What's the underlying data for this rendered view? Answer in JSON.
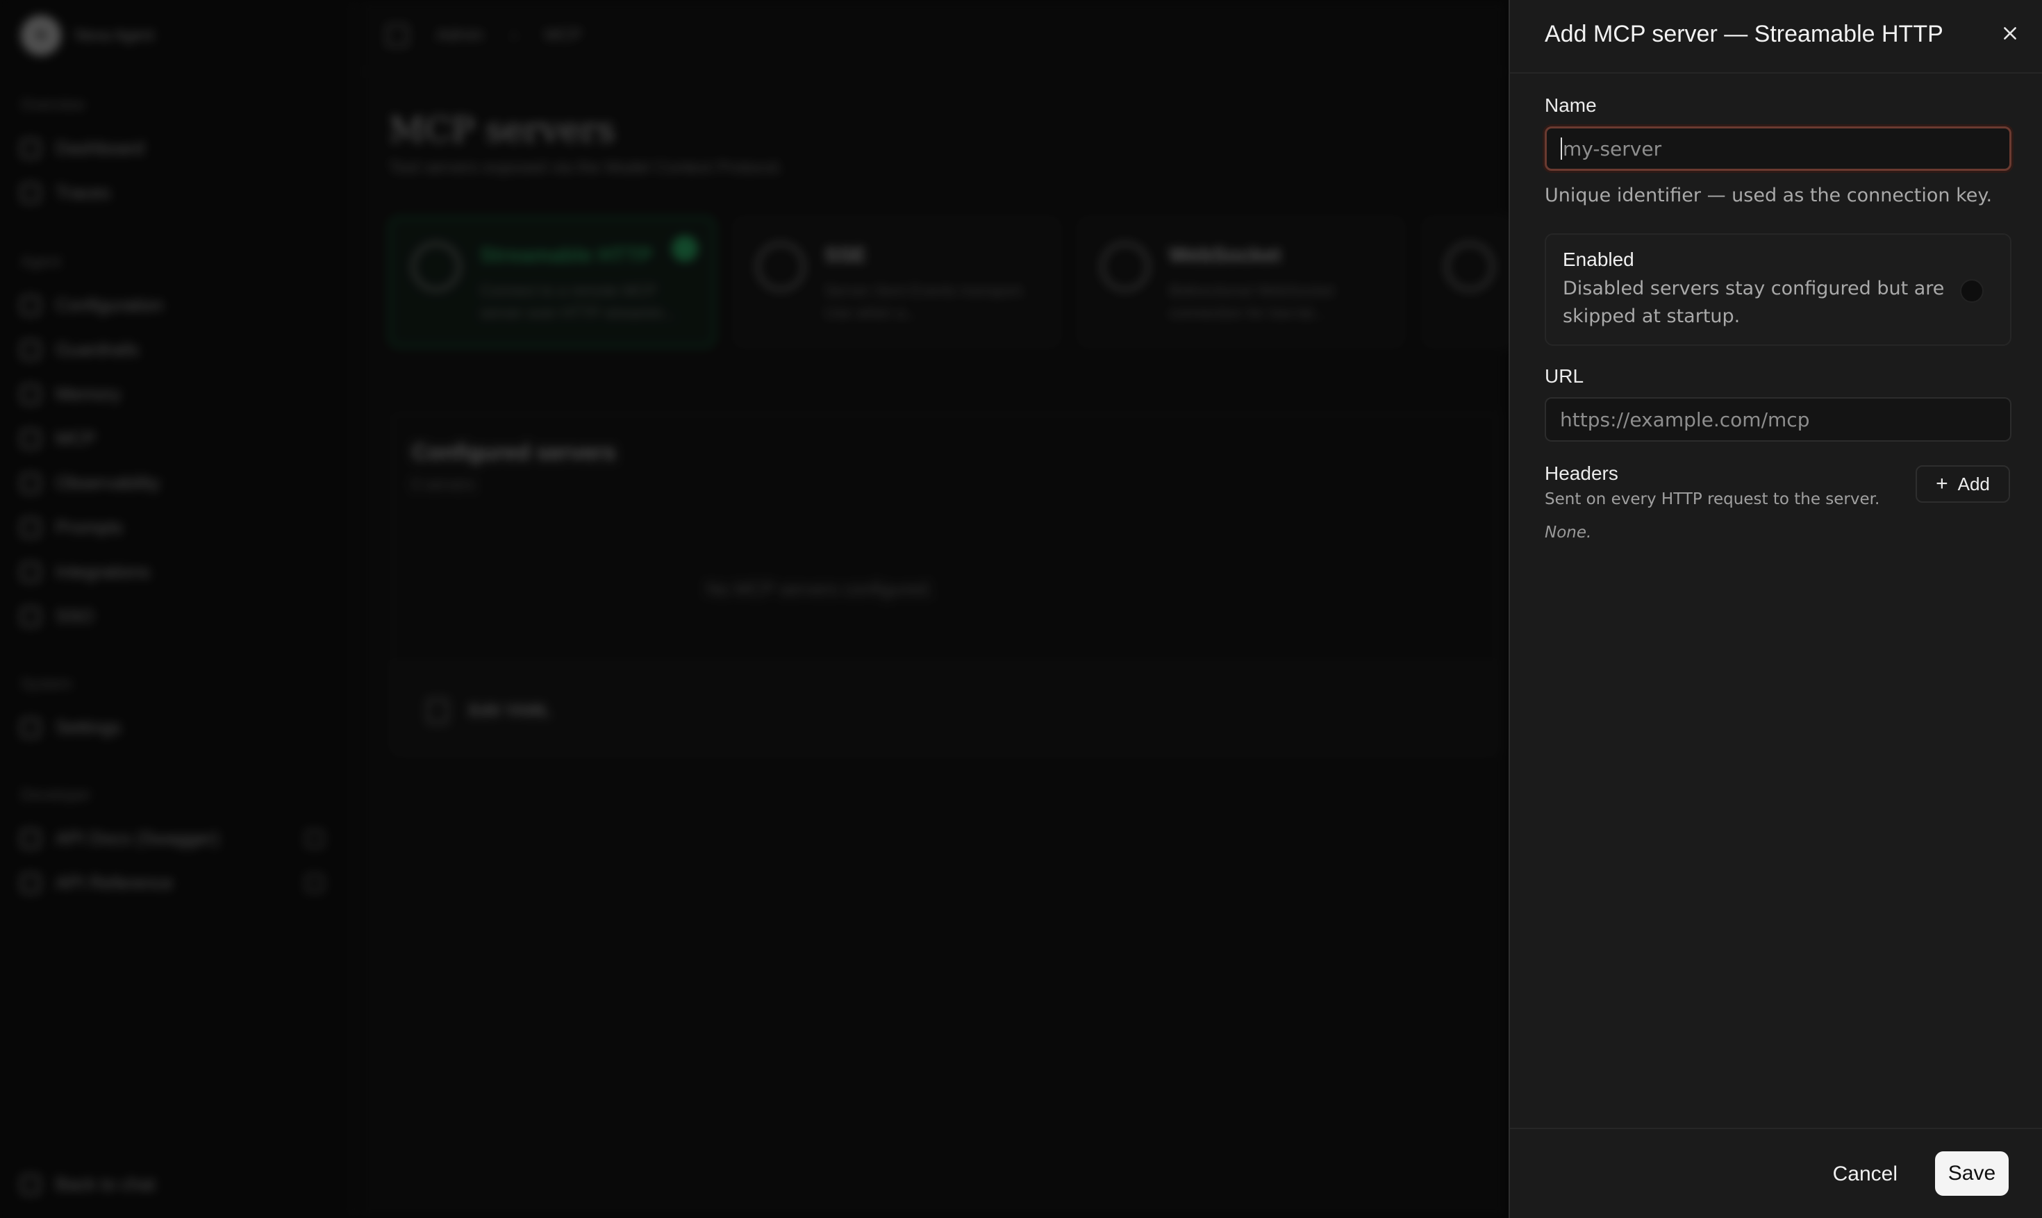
{
  "app": {
    "name": "Nexa Agent",
    "logo_text": "N"
  },
  "sidebar": {
    "sections": [
      {
        "title": "Overview",
        "items": [
          {
            "label": "Dashboard"
          },
          {
            "label": "Traces"
          }
        ]
      },
      {
        "title": "Agent",
        "items": [
          {
            "label": "Configuration"
          },
          {
            "label": "Guardrails"
          },
          {
            "label": "Memory"
          },
          {
            "label": "MCP"
          },
          {
            "label": "Observability"
          },
          {
            "label": "Prompts"
          },
          {
            "label": "Integrations"
          },
          {
            "label": "SSO"
          }
        ]
      },
      {
        "title": "System",
        "items": [
          {
            "label": "Settings"
          }
        ]
      },
      {
        "title": "Developer",
        "items": [
          {
            "label": "API Docs (Swagger)"
          },
          {
            "label": "API Reference"
          }
        ]
      }
    ],
    "back": "Back to chat"
  },
  "breadcrumb": {
    "parent": "Admin",
    "sep": "›",
    "current": "MCP"
  },
  "page": {
    "title": "MCP servers",
    "subtitle": "Tool servers exposed via the Model Context Protocol."
  },
  "transports": [
    {
      "title": "Streamable HTTP",
      "desc": "Connect to a remote MCP server over HTTP streamin...",
      "active": true
    },
    {
      "title": "SSE",
      "desc": "Server-Sent Events transport. Use when a...",
      "active": false
    },
    {
      "title": "WebSocket",
      "desc": "Bidirectional WebSocket connection for low-lat...",
      "active": false
    }
  ],
  "configured": {
    "title": "Configured servers",
    "count": "0 servers",
    "empty": "No MCP servers configured.",
    "footer": "Edit YAML"
  },
  "drawer": {
    "title": "Add MCP server — Streamable HTTP",
    "name_label": "Name",
    "name_placeholder": "my-server",
    "name_help": "Unique identifier — used as the connection key.",
    "enabled_label": "Enabled",
    "enabled_desc": "Disabled servers stay configured but are skipped at startup.",
    "enabled": false,
    "url_label": "URL",
    "url_placeholder": "https://example.com/mcp",
    "headers_label": "Headers",
    "headers_hint": "Sent on every HTTP request to the server.",
    "headers_empty": "None.",
    "add_label": "Add",
    "cancel_label": "Cancel",
    "save_label": "Save"
  }
}
